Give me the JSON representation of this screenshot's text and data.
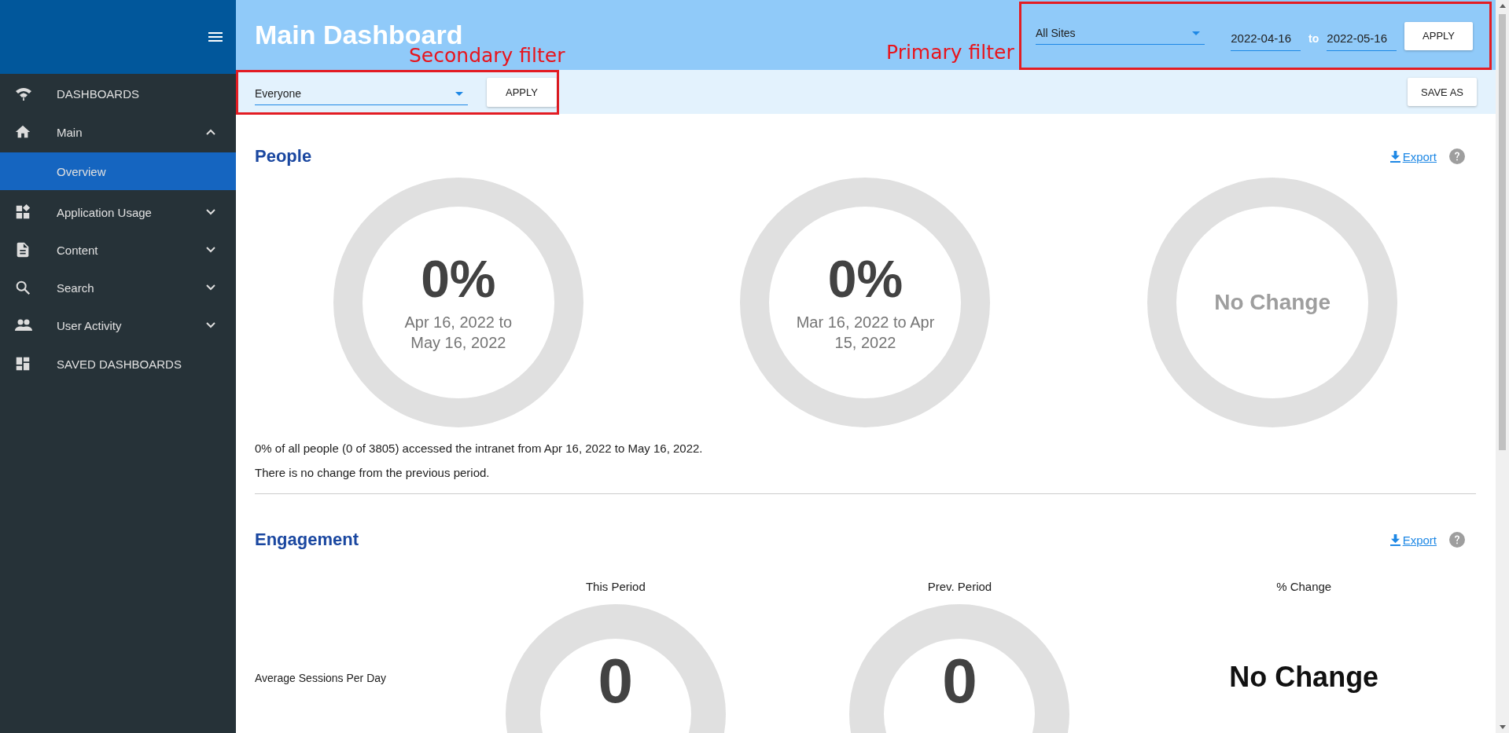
{
  "sidebar": {
    "items": [
      {
        "label": "DASHBOARDS",
        "kind": "section"
      },
      {
        "label": "Main",
        "kind": "group",
        "expanded": true,
        "children": [
          {
            "label": "Overview",
            "selected": true
          }
        ]
      },
      {
        "label": "Application Usage",
        "kind": "group",
        "expanded": false
      },
      {
        "label": "Content",
        "kind": "group",
        "expanded": false
      },
      {
        "label": "Search",
        "kind": "group",
        "expanded": false
      },
      {
        "label": "User Activity",
        "kind": "group",
        "expanded": false
      },
      {
        "label": "SAVED DASHBOARDS",
        "kind": "section"
      }
    ]
  },
  "header": {
    "title": "Main Dashboard",
    "annotations": [
      {
        "label": "Secondary filter"
      },
      {
        "label": "Primary filter"
      }
    ],
    "primary_filter": {
      "site": "All Sites",
      "from": "2022-04-16",
      "separator": "to",
      "to": "2022-05-16",
      "button": "APPLY"
    },
    "secondary_filter": {
      "audience": "Everyone",
      "button": "APPLY"
    },
    "save_button": "SAVE AS"
  },
  "people": {
    "title": "People",
    "export": "Export",
    "rings": [
      {
        "kind": "percent",
        "value": "0%",
        "caption": "Apr 16, 2022 to May 16, 2022"
      },
      {
        "kind": "percent",
        "value": "0%",
        "caption": "Mar 16, 2022 to Apr 15, 2022"
      },
      {
        "kind": "change",
        "value": "No Change"
      }
    ],
    "summary": [
      "0% of all people (0 of 3805) accessed the intranet from Apr 16, 2022 to May 16, 2022.",
      "There is no change from the previous period."
    ]
  },
  "engagement": {
    "title": "Engagement",
    "export": "Export",
    "columns": [
      "This Period",
      "Prev. Period",
      "% Change"
    ],
    "rows": [
      {
        "label": "Average Sessions Per Day",
        "this_period": "0",
        "prev_period": "0",
        "change": "No Change"
      }
    ]
  }
}
